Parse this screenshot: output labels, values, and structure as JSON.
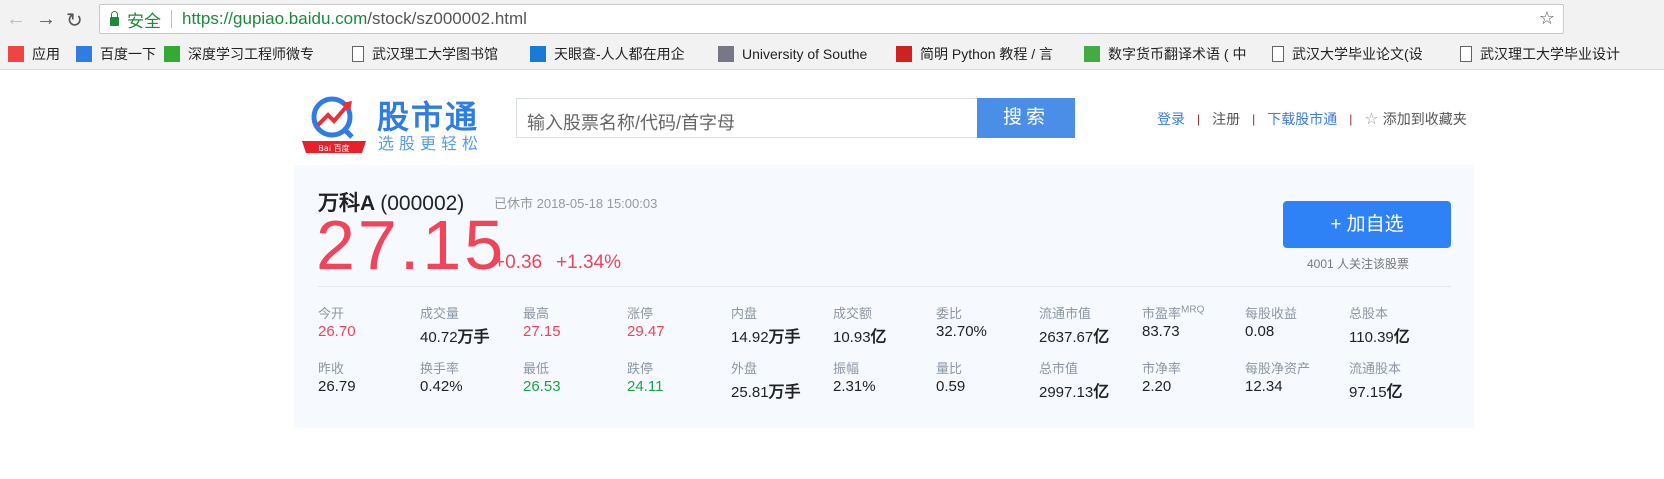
{
  "browser": {
    "secure_label": "安全",
    "url_scheme": "https://",
    "url_host": "gupiao.baidu.com",
    "url_path": "/stock/sz000002.html",
    "bookmarks": [
      "应用",
      "百度一下",
      "深度学习工程师微专",
      "武汉理工大学图书馆",
      "天眼查-人人都在用企",
      "University of Southe",
      "简明 Python 教程 / 言",
      "数字货币翻译术语 ( 中",
      "武汉大学毕业论文(设",
      "武汉理工大学毕业设计"
    ]
  },
  "header": {
    "logo_title": "股市通",
    "logo_sub": "选股更轻松",
    "logo_badge": "Bai百度",
    "search_placeholder": "输入股票名称/代码/首字母",
    "search_button": "搜索",
    "links": {
      "login": "登录",
      "register": "注册",
      "download": "下载股市通",
      "favorite": "添加到收藏夹"
    }
  },
  "stock": {
    "name": "万科A",
    "code": "(000002)",
    "status": "已休市 2018-05-18  15:00:03",
    "price": "27.15",
    "change": "+0.36",
    "change_pct": "+1.34%",
    "add_button": "+ 加自选",
    "followers": "4001 人关注该股票",
    "colors": {
      "up": "#f0445a",
      "down": "#1aa34a"
    },
    "stats": [
      [
        {
          "label": "今开",
          "value": "26.70",
          "unit": "",
          "color": "red"
        },
        {
          "label": "昨收",
          "value": "26.79",
          "unit": "",
          "color": ""
        }
      ],
      [
        {
          "label": "成交量",
          "value": "40.72",
          "unit": "万手",
          "color": ""
        },
        {
          "label": "换手率",
          "value": "0.42%",
          "unit": "",
          "color": ""
        }
      ],
      [
        {
          "label": "最高",
          "value": "27.15",
          "unit": "",
          "color": "red"
        },
        {
          "label": "最低",
          "value": "26.53",
          "unit": "",
          "color": "green"
        }
      ],
      [
        {
          "label": "涨停",
          "value": "29.47",
          "unit": "",
          "color": "red"
        },
        {
          "label": "跌停",
          "value": "24.11",
          "unit": "",
          "color": "green"
        }
      ],
      [
        {
          "label": "内盘",
          "value": "14.92",
          "unit": "万手",
          "color": ""
        },
        {
          "label": "外盘",
          "value": "25.81",
          "unit": "万手",
          "color": ""
        }
      ],
      [
        {
          "label": "成交额",
          "value": "10.93",
          "unit": "亿",
          "color": ""
        },
        {
          "label": "振幅",
          "value": "2.31%",
          "unit": "",
          "color": ""
        }
      ],
      [
        {
          "label": "委比",
          "value": "32.70%",
          "unit": "",
          "color": ""
        },
        {
          "label": "量比",
          "value": "0.59",
          "unit": "",
          "color": ""
        }
      ],
      [
        {
          "label": "流通市值",
          "value": "2637.67",
          "unit": "亿",
          "color": ""
        },
        {
          "label": "总市值",
          "value": "2997.13",
          "unit": "亿",
          "color": ""
        }
      ],
      [
        {
          "label": "市盈率",
          "sup": "MRQ",
          "value": "83.73",
          "unit": "",
          "color": ""
        },
        {
          "label": "市净率",
          "value": "2.20",
          "unit": "",
          "color": ""
        }
      ],
      [
        {
          "label": "每股收益",
          "value": "0.08",
          "unit": "",
          "color": ""
        },
        {
          "label": "每股净资产",
          "value": "12.34",
          "unit": "",
          "color": ""
        }
      ],
      [
        {
          "label": "总股本",
          "value": "110.39",
          "unit": "亿",
          "color": ""
        },
        {
          "label": "流通股本",
          "value": "97.15",
          "unit": "亿",
          "color": ""
        }
      ]
    ]
  }
}
